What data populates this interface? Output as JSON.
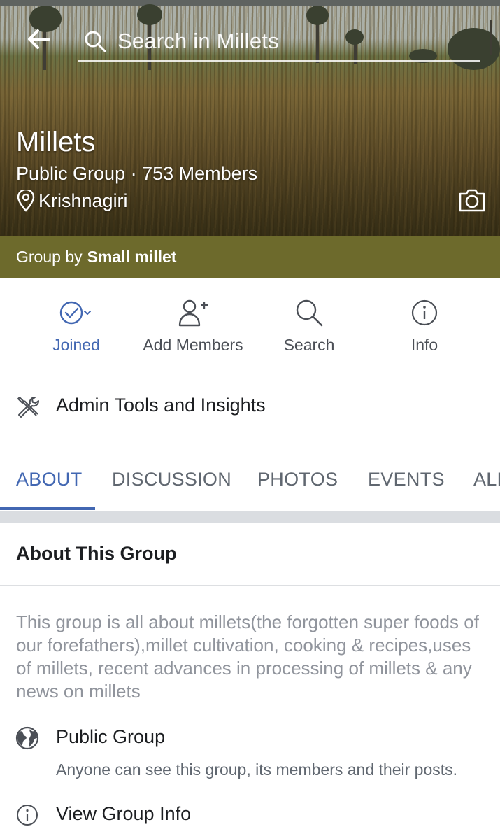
{
  "header": {
    "search_placeholder": "Search in Millets"
  },
  "group": {
    "name": "Millets",
    "subtitle": "Public Group · 753 Members",
    "location": "Krishnagiri",
    "group_by_prefix": "Group by",
    "group_by_owner": "Small millet"
  },
  "actions": [
    {
      "label": "Joined",
      "icon": "check-circle-icon"
    },
    {
      "label": "Add Members",
      "icon": "add-person-icon"
    },
    {
      "label": "Search",
      "icon": "search-icon"
    },
    {
      "label": "Info",
      "icon": "info-icon"
    }
  ],
  "admin": {
    "label": "Admin Tools and Insights",
    "icon": "tools-icon"
  },
  "tabs": [
    {
      "label": "ABOUT",
      "active": true
    },
    {
      "label": "DISCUSSION"
    },
    {
      "label": "PHOTOS"
    },
    {
      "label": "EVENTS"
    },
    {
      "label": "ALL"
    }
  ],
  "about": {
    "heading": "About This Group",
    "description": "This group is all about millets(the forgotten super foods of our forefathers),millet cultivation, cooking & recipes,uses of millets, recent advances in processing of millets & any news on millets",
    "privacy_title": "Public Group",
    "privacy_desc": "Anyone can see this group, its members and their posts.",
    "view_info": "View Group Info"
  },
  "colors": {
    "accent": "#4267b2",
    "group_by_bar": "#6d6a2c",
    "muted_text": "#90949c"
  }
}
